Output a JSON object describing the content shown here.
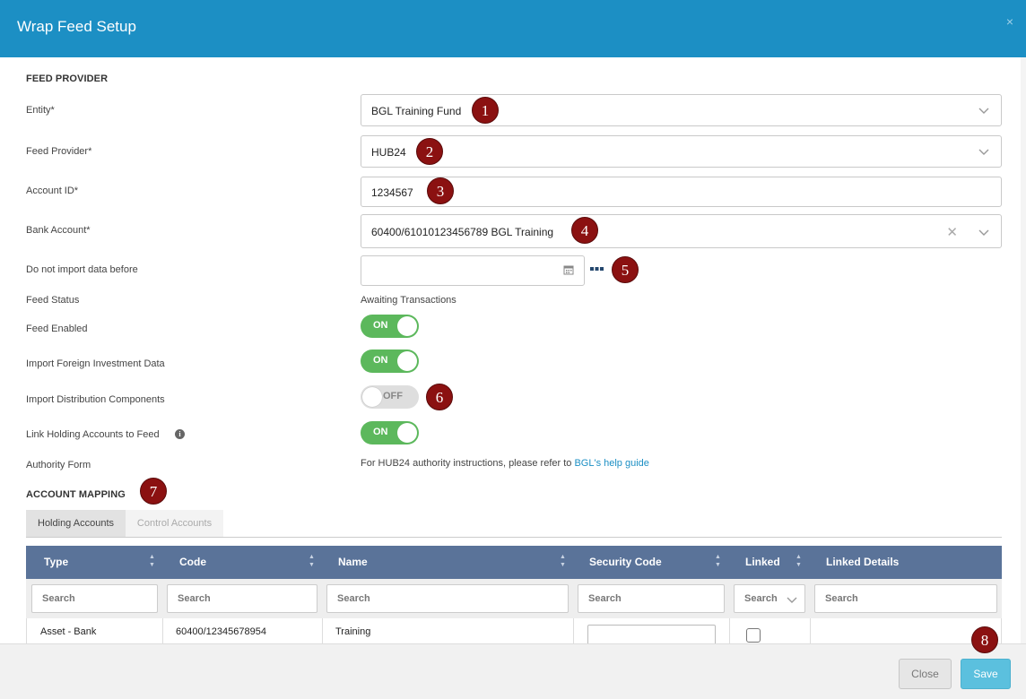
{
  "header": {
    "title": "Wrap Feed Setup",
    "close_glyph": "×"
  },
  "feed_provider": {
    "section_title": "FEED PROVIDER",
    "entity": {
      "label": "Entity*",
      "value": "BGL Training Fund"
    },
    "provider": {
      "label": "Feed Provider*",
      "value": "HUB24"
    },
    "account_id": {
      "label": "Account ID*",
      "value": "1234567"
    },
    "bank_account": {
      "label": "Bank Account*",
      "value": "60400/61010123456789 BGL Training",
      "clear_glyph": "✕"
    },
    "import_before": {
      "label": "Do not import data before",
      "value": ""
    },
    "feed_status": {
      "label": "Feed Status",
      "value": "Awaiting Transactions"
    },
    "feed_enabled": {
      "label": "Feed Enabled",
      "state": "ON"
    },
    "import_foreign": {
      "label": "Import Foreign Investment Data",
      "state": "ON"
    },
    "import_distribution": {
      "label": "Import Distribution Components",
      "state": "OFF"
    },
    "link_holding": {
      "label": "Link Holding Accounts to Feed",
      "state": "ON",
      "info_glyph": "i"
    },
    "authority_form": {
      "label": "Authority Form",
      "text": "For HUB24 authority instructions, please refer to ",
      "link": "BGL's help guide"
    }
  },
  "account_mapping": {
    "section_title": "ACCOUNT MAPPING",
    "tabs": [
      {
        "label": "Holding Accounts"
      },
      {
        "label": "Control Accounts"
      }
    ],
    "columns": [
      "Type",
      "Code",
      "Name",
      "Security Code",
      "Linked",
      "Linked Details"
    ],
    "filters": {
      "type": "Search",
      "code": "Search",
      "name": "Search",
      "security_code": "Search",
      "linked": "Search",
      "linked_details": "Search"
    },
    "rows": [
      {
        "type": "Asset - Bank",
        "code": "60400/12345678954",
        "name": "Training",
        "security_code": "",
        "linked": false,
        "linked_details": ""
      }
    ]
  },
  "badges": [
    "1",
    "2",
    "3",
    "4",
    "5",
    "6",
    "7",
    "8"
  ],
  "footer": {
    "close_label": "Close",
    "save_label": "Save"
  },
  "colors": {
    "header": "#1c8fc4",
    "toggle_on": "#5cb85c",
    "table_header": "#5a7399",
    "save_button": "#5bc0de",
    "badge": "#8b1111",
    "link": "#1c8fc4"
  }
}
